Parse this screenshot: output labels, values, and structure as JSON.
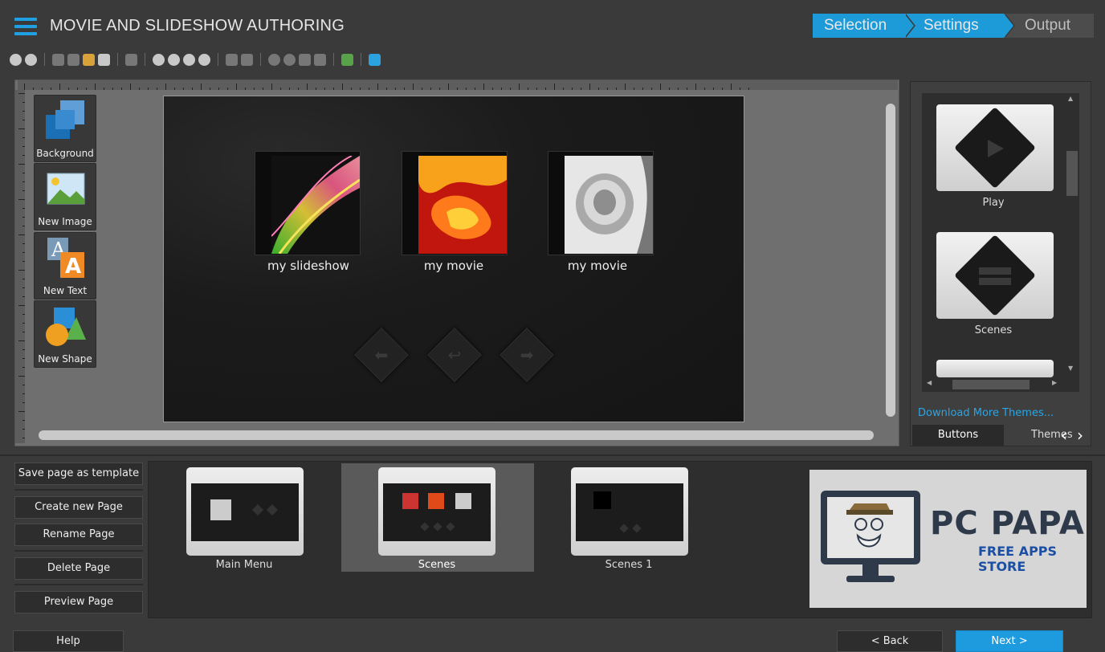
{
  "header": {
    "title": "MOVIE AND SLIDESHOW AUTHORING",
    "steps": [
      "Selection",
      "Settings",
      "Output"
    ],
    "accent": "#1d9bd9"
  },
  "toolbar": {
    "icons": [
      "back-icon",
      "forward-icon",
      "cut-icon",
      "copy-icon",
      "paste-icon",
      "paste-special-icon",
      "delete-icon",
      "zoom-in-icon",
      "zoom-out-icon",
      "zoom-fit-icon",
      "zoom-100-icon",
      "bring-front-icon",
      "send-back-icon",
      "rotate-left-icon",
      "rotate-right-icon",
      "flip-h-icon",
      "flip-v-icon",
      "image-icon",
      "layers-icon"
    ]
  },
  "tools": [
    {
      "label": "Background",
      "icon": "background-icon"
    },
    {
      "label": "New Image",
      "icon": "image-icon"
    },
    {
      "label": "New Text",
      "icon": "text-icon"
    },
    {
      "label": "New Shape",
      "icon": "shape-icon"
    }
  ],
  "stage": {
    "items": [
      {
        "label": "my slideshow"
      },
      {
        "label": "my movie"
      },
      {
        "label": "my movie"
      }
    ]
  },
  "themes_panel": {
    "items": [
      {
        "label": "Play"
      },
      {
        "label": "Scenes"
      }
    ],
    "download_link": "Download More Themes...",
    "tabs": [
      "Buttons",
      "Themes"
    ]
  },
  "page_actions": {
    "save_template": "Save page as template",
    "create": "Create new Page",
    "rename": "Rename Page",
    "delete": "Delete Page",
    "preview": "Preview Page"
  },
  "pages": [
    {
      "label": "Main Menu",
      "selected": false
    },
    {
      "label": "Scenes",
      "selected": true
    },
    {
      "label": "Scenes 1",
      "selected": false
    }
  ],
  "brand": {
    "title": "PC PAPA",
    "subtitle": "FREE APPS STORE"
  },
  "footer": {
    "help": "Help",
    "back": "< Back",
    "next": "Next >"
  }
}
